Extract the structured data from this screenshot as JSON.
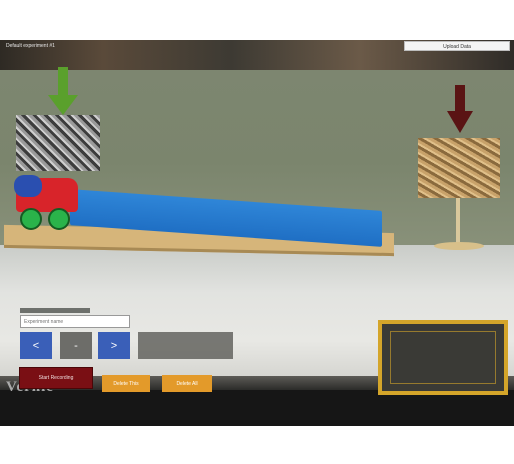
{
  "app": {
    "title": "Default experiment #1"
  },
  "header": {
    "upload_label": "Upload Data"
  },
  "experiment": {
    "name_placeholder": "Experiment name"
  },
  "navigation": {
    "prev_label": "<",
    "minus_label": "-",
    "next_label": ">"
  },
  "controls": {
    "record_label": "Start Recording",
    "delete_this_label": "Delete This",
    "delete_all_label": "Delete All"
  },
  "branding": {
    "logo_text": "Vernie"
  },
  "colors": {
    "record": "#7a0f14",
    "delete": "#e39a2a",
    "nav": "#3a5fb8",
    "preview_border": "#d4a52a",
    "green_arrow": "#5aa02c",
    "red_arrow": "#5a1414"
  },
  "icons": [
    "green-down-arrow-icon",
    "red-down-arrow-icon"
  ]
}
